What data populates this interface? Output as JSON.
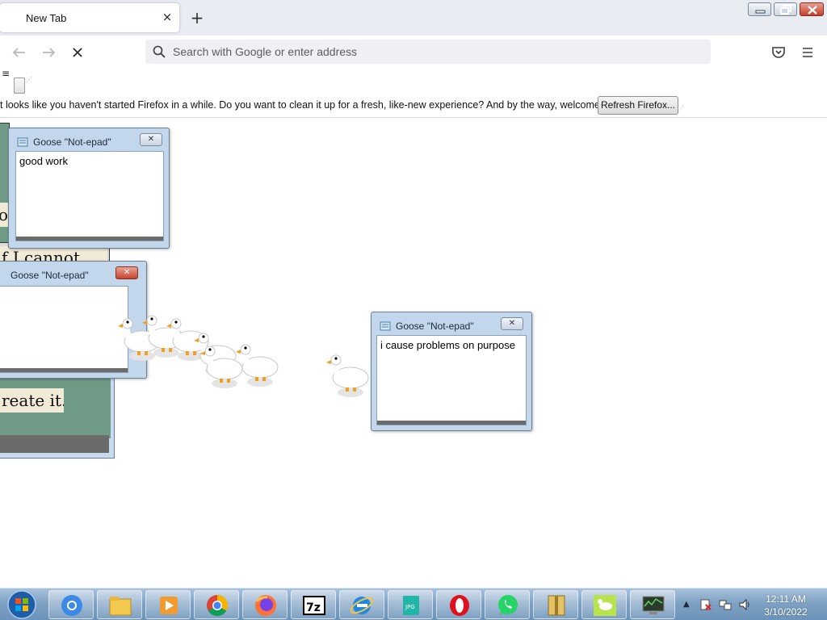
{
  "browser": {
    "tab_title": "New Tab",
    "tab_close": "×",
    "new_tab": "+",
    "url_placeholder": "Search with Google or enter address"
  },
  "notification": {
    "message": "t looks like you haven't started Firefox in a while. Do you want to clean it up for a fresh, like-new experience? And by the way, welcome back!",
    "button_label": "Refresh Firefox..."
  },
  "goose_windows": [
    {
      "title": "Goose \"Not-epad\"",
      "text": "good work"
    },
    {
      "title": "Goose \"Not-epad\"",
      "text": ""
    },
    {
      "title": "Goose \"Not-epad\"",
      "text": "i cause problems on purpose"
    }
  ],
  "meme_window": {
    "line1": "o",
    "line2": "f I cannot",
    "line3": "reate it."
  },
  "taskbar": {
    "apps": [
      "start",
      "chrome-blue",
      "file-explorer",
      "media-player",
      "chrome",
      "firefox",
      "7zip",
      "internet-explorer",
      "jpeg-viewer",
      "opera",
      "whatsapp",
      "archiver",
      "goose-app",
      "task-manager"
    ],
    "clock_time": "12:11 AM",
    "clock_date": "3/10/2022"
  },
  "colors": {
    "taskbar": "#7fa2c4",
    "goose_window_frame": "#c3d7ec",
    "tabstrip": "#e9edf3"
  }
}
